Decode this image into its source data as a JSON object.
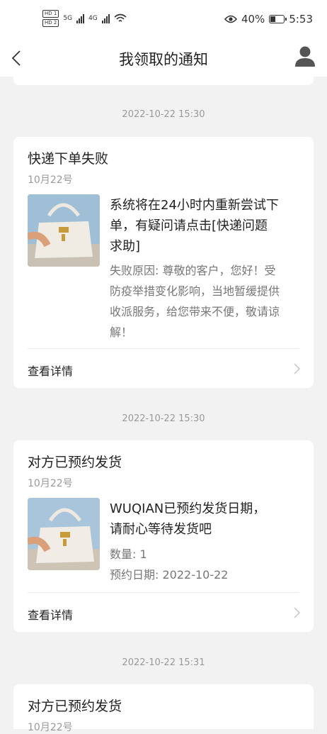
{
  "status_bar": {
    "hd1": "HD 1",
    "hd2": "HD 2",
    "net1": "5G",
    "net2": "4G",
    "battery": "40%",
    "battery_level": 0.4,
    "time": "5:53"
  },
  "nav": {
    "title": "我领取的通知"
  },
  "notifications": [
    {
      "timestamp": "2022-10-22 15:30",
      "title": "快递下单失败",
      "date": "10月22号",
      "message": [
        "系统将在24小时内重新尝试下",
        "单，有疑问请点击[快递问题",
        "求助]"
      ],
      "details": [
        "失败原因: 尊敬的客户，您好！受",
        "防疫举措变化影响，当地暂缓提供",
        "收派服务，给您带来不便，敬请谅",
        "解！"
      ],
      "action": "查看详情"
    },
    {
      "timestamp": "2022-10-22 15:30",
      "title": "对方已预约发货",
      "date": "10月22号",
      "message": [
        "WUQIAN已预约发货日期，",
        "请耐心等待发货吧"
      ],
      "details": [
        "数量: 1",
        "预约日期: 2022-10-22"
      ],
      "action": "查看详情"
    },
    {
      "timestamp": "2022-10-22 15:31",
      "title": "对方已预约发货",
      "date": "10月22号"
    }
  ],
  "colors": {
    "background": "#f2f2f2",
    "card": "#ffffff",
    "muted_text": "#999999"
  }
}
